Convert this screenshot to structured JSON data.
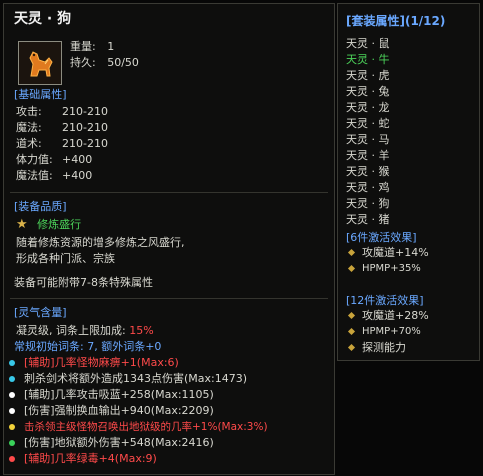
{
  "item": {
    "name": "天灵 · 狗",
    "weight_label": "重量:",
    "weight": "1",
    "durability_label": "持久:",
    "durability": "50/50"
  },
  "base_attrs": {
    "header": "[基础属性]",
    "rows": [
      {
        "label": "攻击:",
        "value": "210-210"
      },
      {
        "label": "魔法:",
        "value": "210-210"
      },
      {
        "label": "道术:",
        "value": "210-210"
      },
      {
        "label": "体力值:",
        "value": "+400"
      },
      {
        "label": "魔法值:",
        "value": "+400"
      }
    ]
  },
  "quality": {
    "header": "[装备品质]",
    "name": "修炼盛行",
    "desc1": "随着修炼资源的增多修炼之风盛行,",
    "desc2": "形成各种门派、宗族",
    "note": "装备可能附带7-8条特殊属性"
  },
  "spirit": {
    "header": "[灵气含量]",
    "line1_prefix": "凝灵级, 词条上限加成: ",
    "line1_value": "15%",
    "line2": "常规初始词条: 7, 额外词条+0",
    "entries": [
      {
        "text": "[辅助]几率怪物麻痹+1(Max:6)",
        "color": "#ff4a4a",
        "bullet": "#38c8e8"
      },
      {
        "text": "刺杀剑术将额外造成1343点伤害(Max:1473)",
        "color": "#d8d8d0",
        "bullet": "#38c8e8"
      },
      {
        "text": "[辅助]几率攻击吸蓝+258(Max:1105)",
        "color": "#d8d8d0",
        "bullet": "#ffffff"
      },
      {
        "text": "[伤害]强制换血输出+940(Max:2209)",
        "color": "#d8d8d0",
        "bullet": "#ffffff"
      },
      {
        "text": "击杀领主级怪物召唤出地狱级的几率+1%(Max:3%)",
        "color": "#ff4a4a",
        "bullet": "#f2d23a"
      },
      {
        "text": "[伤害]地狱额外伤害+548(Max:2416)",
        "color": "#d8d8d0",
        "bullet": "#3ad25a"
      },
      {
        "text": "[辅助]几率绿毒+4(Max:9)",
        "color": "#ff4a4a",
        "bullet": "#ff4a4a"
      }
    ]
  },
  "set": {
    "header": "[套装属性](1/12)",
    "members": [
      {
        "name": "天灵 · 鼠",
        "active": false
      },
      {
        "name": "天灵 · 牛",
        "active": true
      },
      {
        "name": "天灵 · 虎",
        "active": false
      },
      {
        "name": "天灵 · 兔",
        "active": false
      },
      {
        "name": "天灵 · 龙",
        "active": false
      },
      {
        "name": "天灵 · 蛇",
        "active": false
      },
      {
        "name": "天灵 · 马",
        "active": false
      },
      {
        "name": "天灵 · 羊",
        "active": false
      },
      {
        "name": "天灵 · 猴",
        "active": false
      },
      {
        "name": "天灵 · 鸡",
        "active": false
      },
      {
        "name": "天灵 · 狗",
        "active": false
      },
      {
        "name": "天灵 · 猪",
        "active": false
      }
    ],
    "bonus6_header": "[6件激活效果]",
    "bonus6": [
      "攻魔道+14%",
      "HPMP+35%"
    ],
    "bonus12_header": "[12件激活效果]",
    "bonus12": [
      "攻魔道+28%",
      "HPMP+70%",
      "探测能力"
    ]
  },
  "colors": {
    "blue": "#6aa8ff",
    "green": "#4cd35a",
    "red": "#ff4a4a",
    "gold": "#c9a43b"
  }
}
